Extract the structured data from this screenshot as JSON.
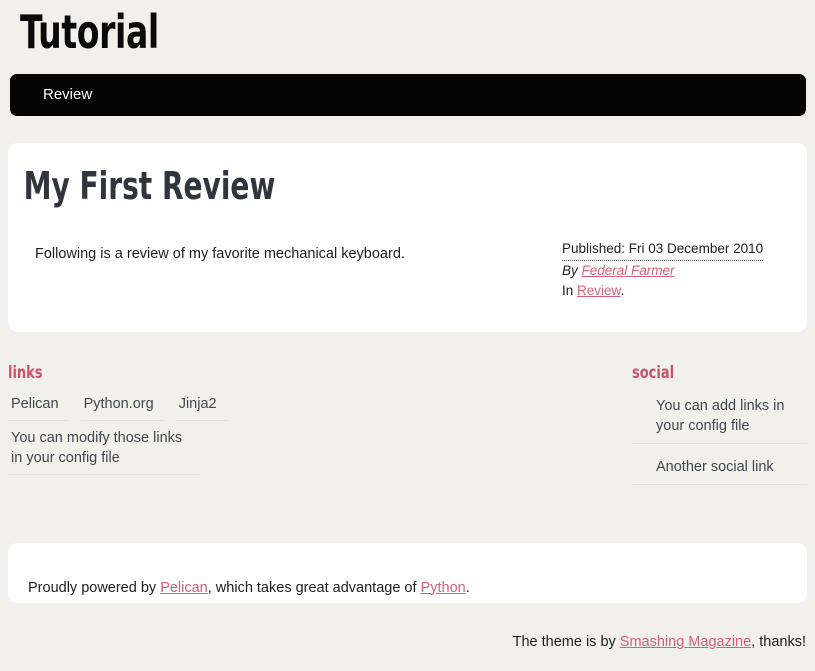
{
  "site": {
    "title": "Tutorial"
  },
  "nav": {
    "items": [
      {
        "label": "Review"
      }
    ]
  },
  "article": {
    "title": "My First Review",
    "body": "Following is a review of my favorite mechanical keyboard.",
    "meta": {
      "published": "Published: Fri 03 December 2010",
      "by_label": "By",
      "author": "Federal Farmer",
      "in_label": "In",
      "category": "Review",
      "period": "."
    }
  },
  "links_widget": {
    "heading": "links",
    "items": [
      {
        "label": "Pelican"
      },
      {
        "label": "Python.org"
      },
      {
        "label": "Jinja2"
      },
      {
        "label": "You can modify those links in your config file"
      }
    ]
  },
  "social_widget": {
    "heading": "social",
    "items": [
      {
        "label": "You can add links in your config file"
      },
      {
        "label": "Another social link"
      }
    ]
  },
  "footer": {
    "prefix": "Proudly powered by ",
    "pelican_link": "Pelican",
    "middle": ", which takes great advantage of ",
    "python_link": "Python",
    "suffix": "."
  },
  "attribution": {
    "prefix": "The theme is by ",
    "link": "Smashing Magazine",
    "suffix": ", thanks!"
  },
  "colors": {
    "background": "#f2f0eb",
    "card": "#ffffff",
    "nav_bar": "#050505",
    "accent_link": "#d4607c",
    "widget_heading": "#cc4f6c",
    "widget_border": "#efdcdf",
    "text": "#1d1d1d"
  }
}
